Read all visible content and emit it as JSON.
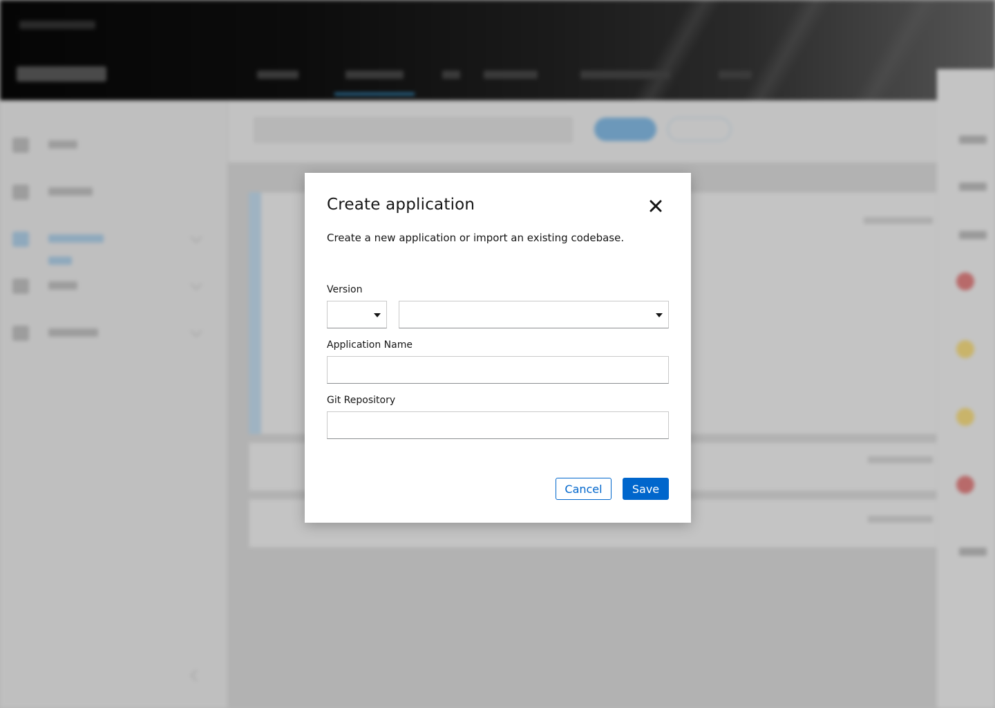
{
  "modal": {
    "title": "Create application",
    "description": "Create a new application or import an existing codebase.",
    "close_icon": "close-icon",
    "version": {
      "label": "Version",
      "runtime_value": "",
      "version_value": ""
    },
    "app_name": {
      "label": "Application Name",
      "value": "",
      "placeholder": ""
    },
    "git_repo": {
      "label": "Git Repository",
      "value": "",
      "placeholder": ""
    },
    "cancel_label": "Cancel",
    "save_label": "Save"
  },
  "colors": {
    "primary": "#0066cc",
    "text": "#151515",
    "backdrop": "#b5b5b5",
    "topbar": "#050505"
  },
  "background_icons": {
    "sidebar": [
      "home-icon",
      "overview-icon",
      "applications-icon",
      "code-icon",
      "settings-icon"
    ],
    "status_error": "error-icon",
    "status_warning": "warning-icon"
  }
}
